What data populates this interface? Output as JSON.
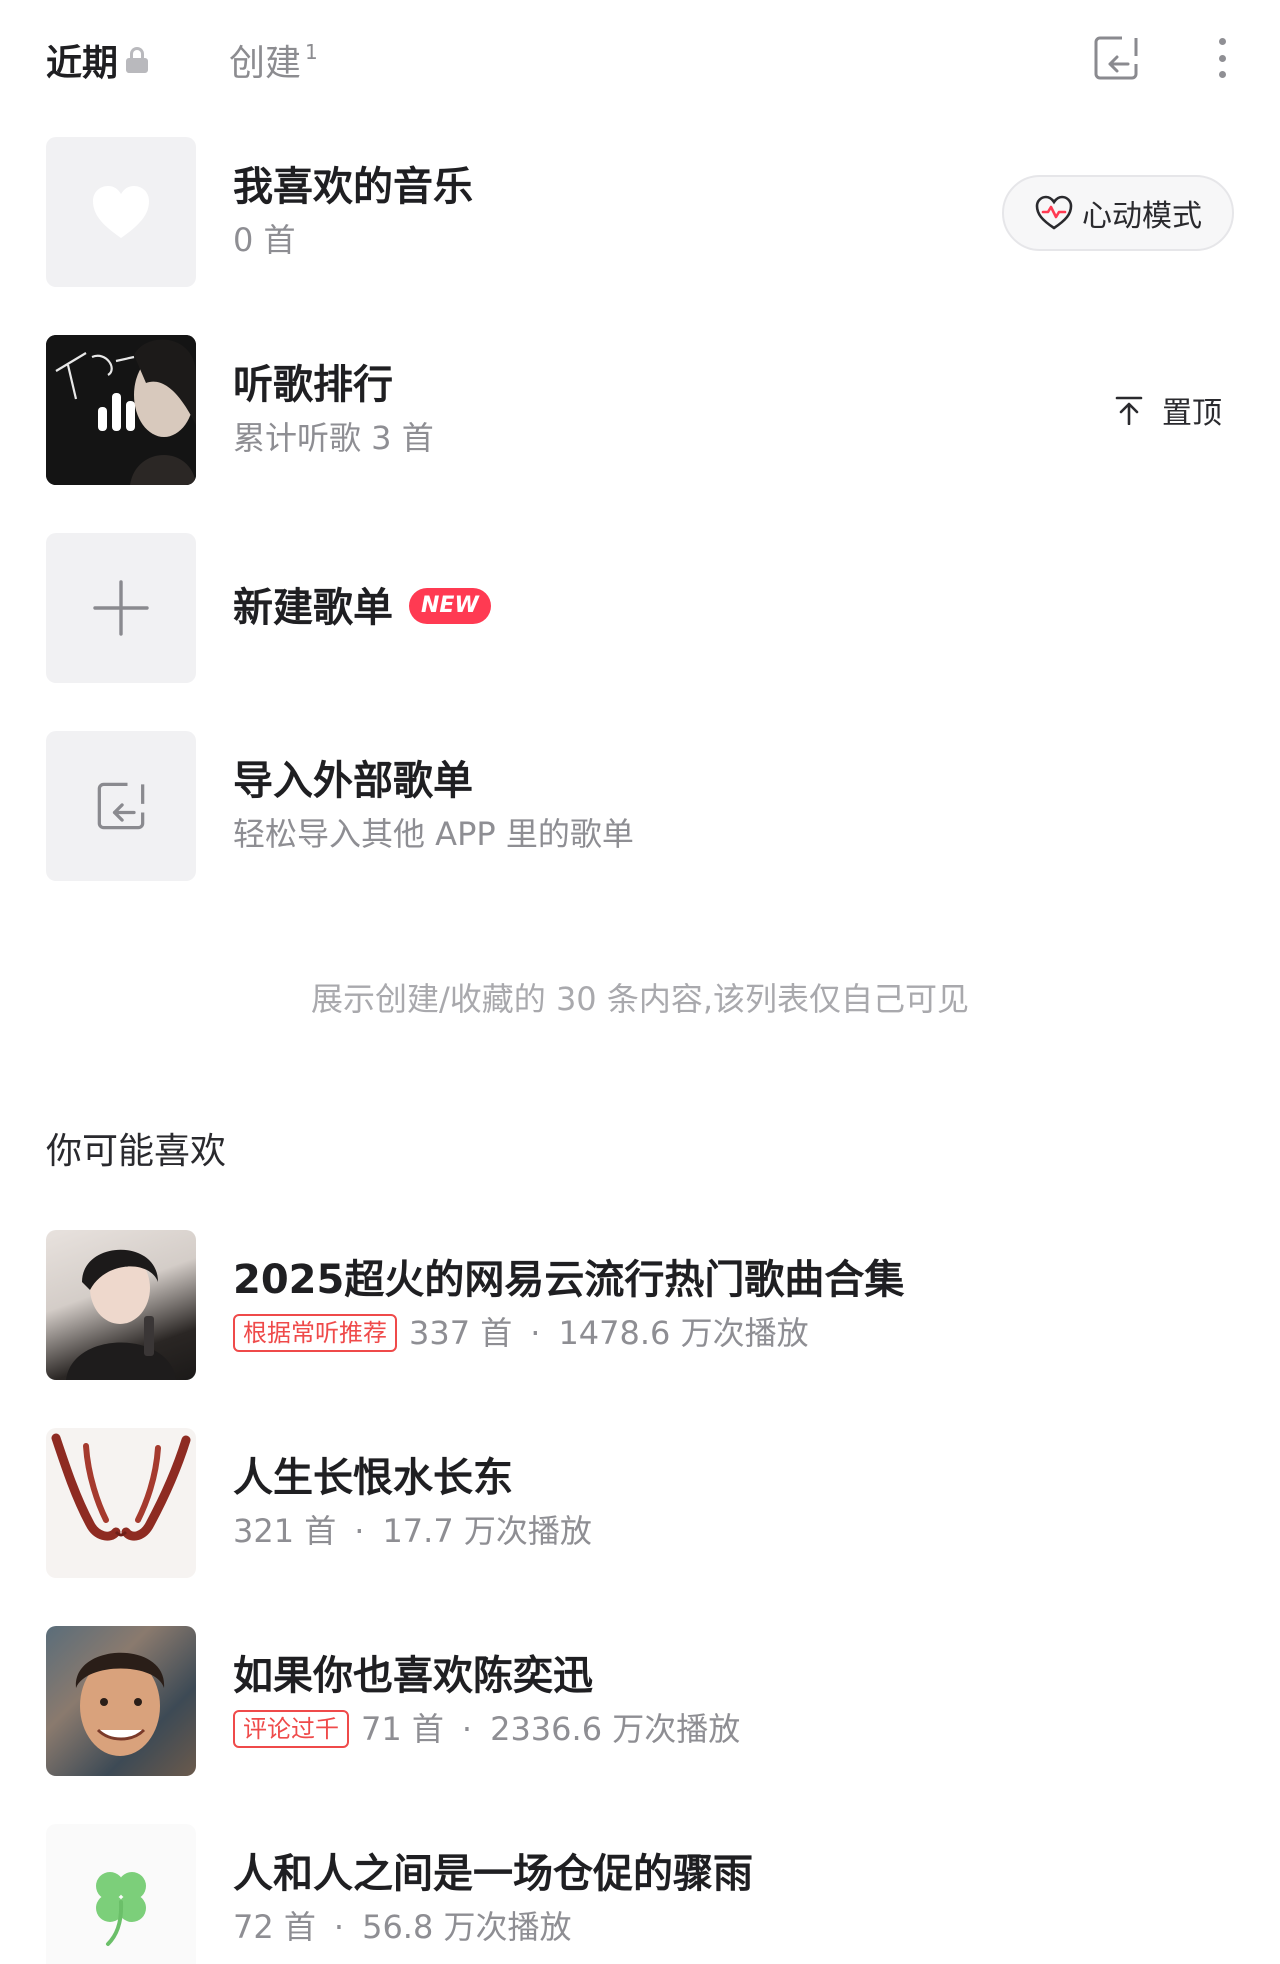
{
  "tabs": {
    "recent": "近期",
    "created": "创建",
    "created_count": "1"
  },
  "playlists": [
    {
      "title": "我喜欢的音乐",
      "subtitle": "0 首",
      "action_label": "心动模式"
    },
    {
      "title": "听歌排行",
      "subtitle": "累计听歌 3 首",
      "action_label": "置顶"
    },
    {
      "title": "新建歌单",
      "badge": "NEW"
    },
    {
      "title": "导入外部歌单",
      "subtitle": "轻松导入其他 APP 里的歌单"
    }
  ],
  "footer_note": "展示创建/收藏的 30 条内容,该列表仅自己可见",
  "recommend": {
    "title": "你可能喜欢",
    "items": [
      {
        "title": "2025超火的网易云流行热门歌曲合集",
        "tag": "根据常听推荐",
        "count": "337 首",
        "plays": "1478.6 万次播放"
      },
      {
        "title": "人生长恨水长东",
        "count": "321 首",
        "plays": "17.7 万次播放"
      },
      {
        "title": "如果你也喜欢陈奕迅",
        "tag": "评论过千",
        "count": "71 首",
        "plays": "2336.6 万次播放"
      },
      {
        "title": "人和人之间是一场仓促的骤雨",
        "count": "72 首",
        "plays": "56.8 万次播放"
      }
    ]
  },
  "colors": {
    "accent_red": "#ff3a52",
    "tag_red": "#ef4a4a",
    "muted_text": "#8e8e93"
  }
}
